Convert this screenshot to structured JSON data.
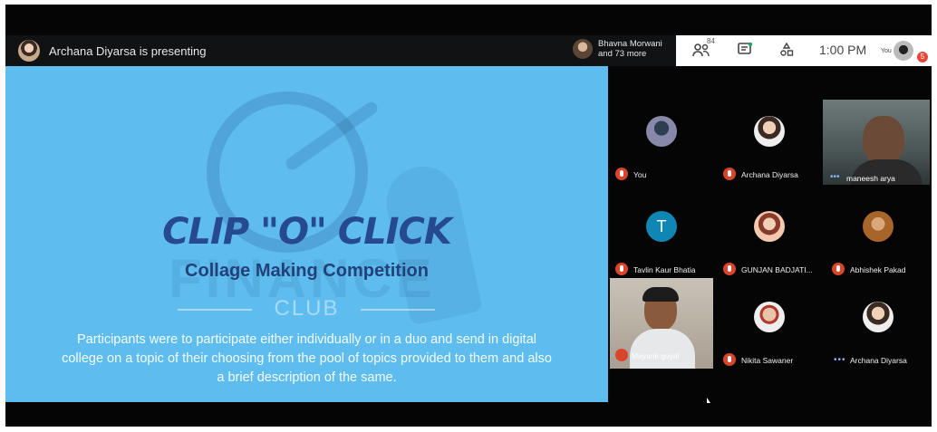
{
  "header": {
    "presenting_text": "Archana Diyarsa is presenting",
    "others_line1": "Bhavna Morwani",
    "others_line2": "and 73 more",
    "participants_count": "84",
    "clock": "1:00 PM",
    "you_label": "You",
    "notification_count": "5"
  },
  "slide": {
    "title": "CLIP \"O\" CLICK",
    "subtitle": "Collage Making Competition",
    "club_text": "CLUB",
    "description": "Participants were to participate either individually or in a duo and send in digital college on a topic of their choosing from the pool of topics provided to them and also a brief description of the same."
  },
  "participants": [
    {
      "name": "You",
      "muted": true
    },
    {
      "name": "Archana Diyarsa",
      "muted": true
    },
    {
      "name": "maneesh arya",
      "muted": false
    },
    {
      "name": "Tavlin Kaur Bhatia",
      "muted": true,
      "initial": "T"
    },
    {
      "name": "GUNJAN BADJATI...",
      "muted": true
    },
    {
      "name": "Abhishek Pakad",
      "muted": true
    },
    {
      "name": "Mayank goyal",
      "muted": true
    },
    {
      "name": "Nikita Sawaner",
      "muted": true
    },
    {
      "name": "Archana Diyarsa",
      "muted": false
    }
  ],
  "icons": [
    "people-icon",
    "chat-icon",
    "activities-icon",
    "mic-off-icon",
    "more-dots-icon"
  ],
  "colors": {
    "slide_bg": "#5ebdee",
    "title": "#26498f",
    "mic_muted": "#d9452b",
    "avatar_t": "#0f86b3"
  }
}
